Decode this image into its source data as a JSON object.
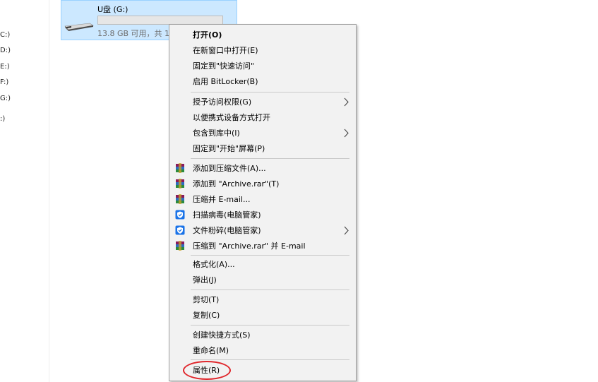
{
  "nav_pane": {
    "items": [
      "C:)",
      "D:)",
      "E:)",
      "F:)",
      "G:)",
      ":)"
    ]
  },
  "drive": {
    "name": "U盘 (G:)",
    "space_text": "13.8 GB 可用，共 1",
    "used_fraction": 0.0,
    "icon": "usb-drive-icon"
  },
  "context_menu": {
    "group1": [
      "打开(O)",
      "在新窗口中打开(E)",
      "固定到\"快速访问\"",
      "启用 BitLocker(B)"
    ],
    "group2": [
      "授予访问权限(G)",
      "以便携式设备方式打开",
      "包含到库中(I)",
      "固定到\"开始\"屏幕(P)"
    ],
    "group3": [
      "添加到压缩文件(A)...",
      "添加到 \"Archive.rar\"(T)",
      "压缩并 E-mail...",
      "扫描病毒(电脑管家)",
      "文件粉碎(电脑管家)",
      "压缩到 \"Archive.rar\" 并 E-mail"
    ],
    "group4": [
      "格式化(A)...",
      "弹出(J)"
    ],
    "group5": [
      "剪切(T)",
      "复制(C)"
    ],
    "group6": [
      "创建快捷方式(S)",
      "重命名(M)"
    ],
    "group7": [
      "属性(R)"
    ],
    "icons": {
      "winrar": "winrar-icon",
      "tencent": "tencent-pc-manager-icon",
      "arrow": "chevron-right-icon"
    }
  },
  "annotation": {
    "color": "#e0262b"
  }
}
